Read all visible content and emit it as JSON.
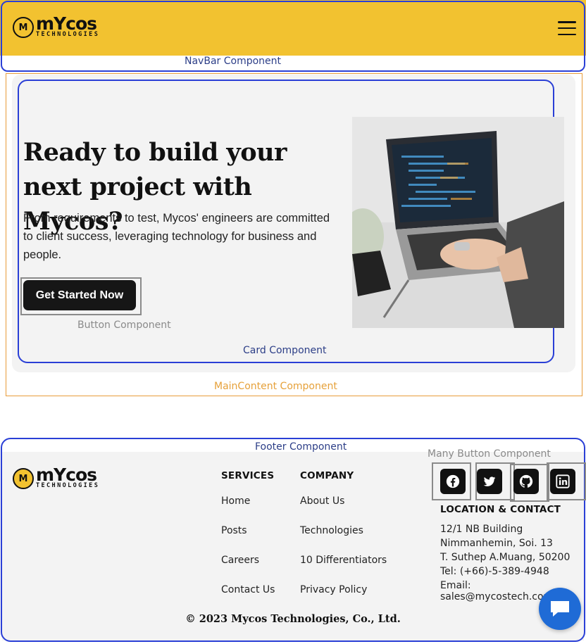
{
  "brand": {
    "name": "mYcos",
    "sub": "TECHNOLOGIES",
    "mark": "M"
  },
  "nav": {
    "component_label": "NavBar Component"
  },
  "hero": {
    "title": "Ready to build your next project with Mycos?",
    "text": "From requirements to test, Mycos' engineers are committed to client success, leveraging technology for business and people.",
    "cta_label": "Get Started Now",
    "button_component_label": "Button Component",
    "card_component_label": "Card Component",
    "main_component_label": "MainContent Component"
  },
  "footer": {
    "component_label": "Footer Component",
    "many_button_label": "Many Button Component",
    "services": {
      "heading": "SERVICES",
      "links": [
        "Home",
        "Posts",
        "Careers",
        "Contact Us"
      ]
    },
    "company": {
      "heading": "COMPANY",
      "links": [
        "About Us",
        "Technologies",
        "10 Differentiators",
        "Privacy Policy"
      ]
    },
    "social": [
      "facebook-icon",
      "twitter-icon",
      "github-icon",
      "linkedin-icon"
    ],
    "location": {
      "heading": "LOCATION & CONTACT",
      "lines": [
        "12/1 NB Building",
        "Nimmanhemin, Soi. 13",
        "T. Suthep A.Muang, 50200",
        "Tel: (+66)-5-389-4948",
        "Email: sales@mycostech.com"
      ]
    },
    "copyright": "© 2023 Mycos Technologies, Co., Ltd."
  },
  "colors": {
    "navbar": "#f2c230",
    "outline_blue": "#2a3fd6",
    "outline_orange": "#e89c3a",
    "chat": "#1f6bd6"
  }
}
